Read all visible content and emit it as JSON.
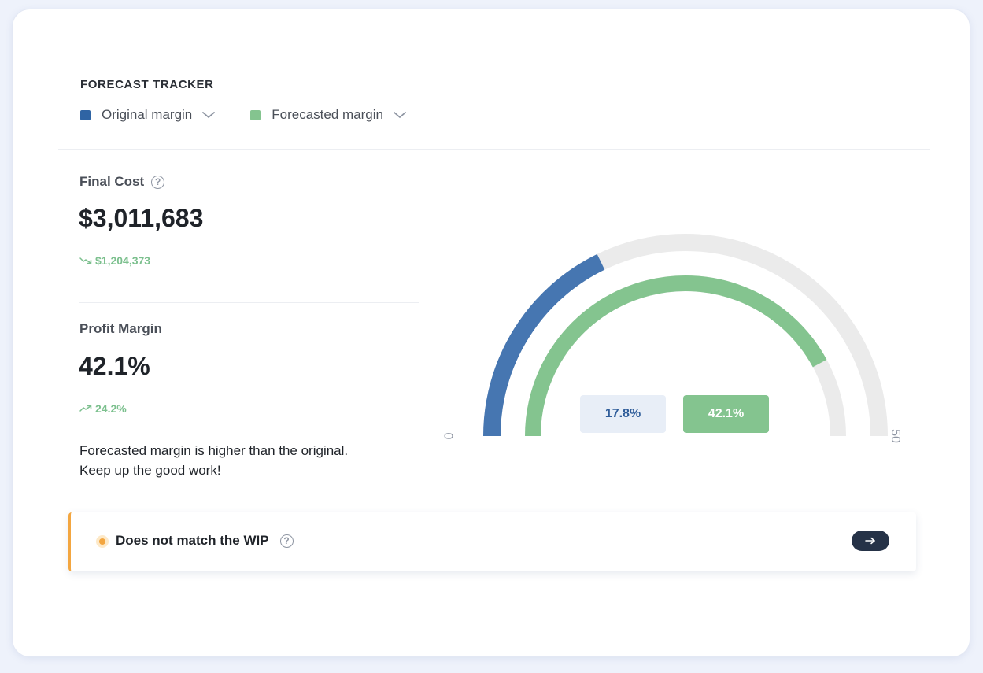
{
  "header": {
    "title": "FORECAST TRACKER"
  },
  "legend": [
    {
      "label": "Original margin",
      "color": "#2f64a4",
      "icon": "chevron-down-icon"
    },
    {
      "label": "Forecasted margin",
      "color": "#84c48f",
      "icon": "chevron-down-icon"
    }
  ],
  "final_cost": {
    "label": "Final Cost",
    "value": "$3,011,683",
    "delta": "$1,204,373",
    "delta_direction": "down"
  },
  "profit_margin": {
    "label": "Profit Margin",
    "value": "42.1%",
    "delta": "24.2%",
    "delta_direction": "up"
  },
  "message": {
    "line1": "Forecasted margin is higher than the original.",
    "line2": "Keep up the good work!"
  },
  "gauge": {
    "min_label": "0",
    "max_label": "50",
    "min": 0,
    "max": 50,
    "original": {
      "value": 17.8,
      "label": "17.8%",
      "color": "#4676b1"
    },
    "forecasted": {
      "value": 42.1,
      "label": "42.1%",
      "color": "#84c48f"
    },
    "track_color": "#ebebeb"
  },
  "alert": {
    "text": "Does not match the WIP",
    "accent": "#f3a640",
    "button_icon": "arrow-right-icon"
  }
}
